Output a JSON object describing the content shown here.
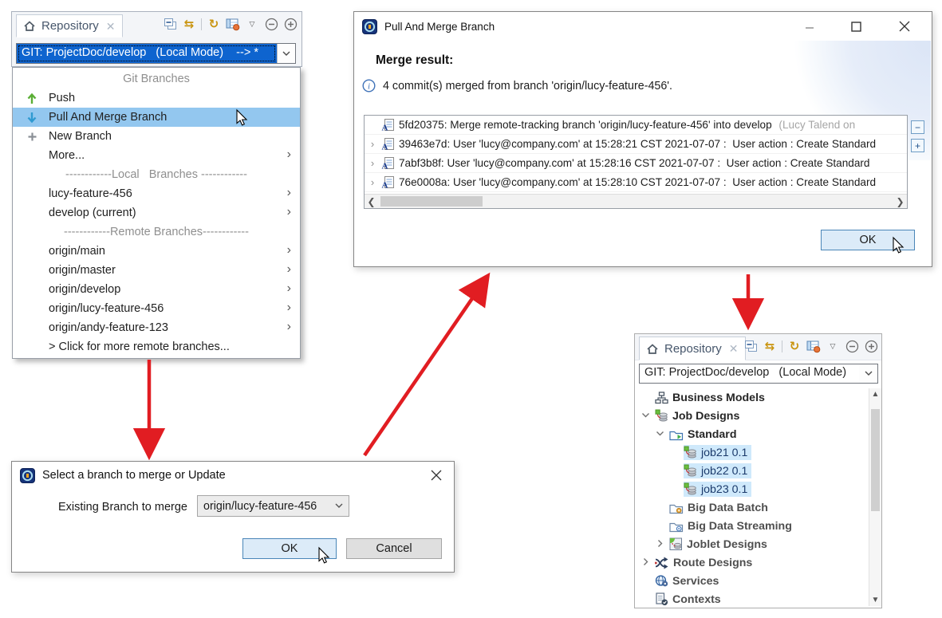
{
  "colors": {
    "selection_blue": "#0e64cf",
    "menu_highlight": "#93c7ef",
    "tree_selection": "#cfe9fb",
    "ok_button_bg": "#dcebf8",
    "ok_button_border": "#4a86b8",
    "arrow_red": "#e11d22",
    "toolbar_gold": "#c9940f"
  },
  "toolbar_icons": [
    {
      "name": "collapse-all-icon"
    },
    {
      "name": "switch-branch-icon"
    },
    {
      "name": "separator"
    },
    {
      "name": "refresh-icon"
    },
    {
      "name": "project-settings-icon"
    },
    {
      "name": "view-menu-icon"
    },
    {
      "name": "minimize-view-icon"
    },
    {
      "name": "maximize-view-icon"
    }
  ],
  "panel_top_left": {
    "tab_label": "Repository",
    "combo_value": "GIT: ProjectDoc/develop   (Local Mode)    --> *",
    "menu_items": [
      {
        "type": "header",
        "label": "Git Branches"
      },
      {
        "label": "Push",
        "icon": "push-arrow-up-icon"
      },
      {
        "label": "Pull And Merge Branch",
        "icon": "pull-arrow-down-icon",
        "highlighted": true
      },
      {
        "label": "New Branch",
        "icon": "plus-icon"
      },
      {
        "label": "More...",
        "submenu": true
      },
      {
        "type": "separator",
        "label": "------------Local   Branches ------------"
      },
      {
        "label": "lucy-feature-456",
        "submenu": true
      },
      {
        "label": "develop (current)",
        "submenu": true
      },
      {
        "type": "separator",
        "label": "------------Remote Branches------------"
      },
      {
        "label": "origin/main",
        "submenu": true
      },
      {
        "label": "origin/master",
        "submenu": true
      },
      {
        "label": "origin/develop",
        "submenu": true
      },
      {
        "label": "origin/lucy-feature-456",
        "submenu": true
      },
      {
        "label": "origin/andy-feature-123",
        "submenu": true
      },
      {
        "label": "> Click for more remote branches..."
      }
    ]
  },
  "dialog_merge": {
    "title": "Pull And Merge Branch",
    "heading": "Merge result:",
    "info_text": "4 commit(s) merged from branch 'origin/lucy-feature-456'.",
    "commits": [
      {
        "expandable": false,
        "text": "5fd20375: Merge remote-tracking branch 'origin/lucy-feature-456' into develop ",
        "suffix": "(Lucy Talend on"
      },
      {
        "expandable": true,
        "text": "39463e7d: User 'lucy@company.com' at 15:28:21 CST 2021-07-07 :  User action : Create Standard"
      },
      {
        "expandable": true,
        "text": "7abf3b8f: User 'lucy@company.com' at 15:28:16 CST 2021-07-07 :  User action : Create Standard"
      },
      {
        "expandable": true,
        "text": "76e0008a: User 'lucy@company.com' at 15:28:10 CST 2021-07-07 :  User action : Create Standard"
      }
    ],
    "ok_label": "OK"
  },
  "dialog_select": {
    "title": "Select a branch to merge or Update",
    "field_label": "Existing Branch to merge",
    "field_value": "origin/lucy-feature-456",
    "ok_label": "OK",
    "cancel_label": "Cancel"
  },
  "panel_bottom_right": {
    "tab_label": "Repository",
    "combo_value": "GIT: ProjectDoc/develop   (Local Mode)",
    "tree_items": [
      {
        "label": "Business Models",
        "icon": "business-models-icon",
        "level": 1,
        "bold": true
      },
      {
        "label": "Job Designs",
        "icon": "job-icon",
        "level": 1,
        "bold": true,
        "expander": "down"
      },
      {
        "label": "Standard",
        "icon": "folder-run-icon",
        "level": 2,
        "bold": true,
        "expander": "down"
      },
      {
        "label": "job21 0.1",
        "icon": "job-icon",
        "level": 3,
        "selected": true
      },
      {
        "label": "job22 0.1",
        "icon": "job-icon",
        "level": 3,
        "selected": true
      },
      {
        "label": "job23 0.1",
        "icon": "job-icon",
        "level": 3,
        "selected": true
      },
      {
        "label": "Big Data Batch",
        "icon": "folder-gear-icon",
        "level": 2,
        "bold": true,
        "dim": true
      },
      {
        "label": "Big Data Streaming",
        "icon": "folder-stream-icon",
        "level": 2,
        "bold": true,
        "dim": true
      },
      {
        "label": "Joblet Designs",
        "icon": "joblet-icon",
        "level": 2,
        "bold": true,
        "dim": true,
        "expander": "right"
      },
      {
        "label": "Route Designs",
        "icon": "route-icon",
        "level": 1,
        "bold": true,
        "dim": true,
        "expander": "right"
      },
      {
        "label": "Services",
        "icon": "services-icon",
        "level": 1,
        "bold": true,
        "dim": true
      },
      {
        "label": "Contexts",
        "icon": "contexts-icon",
        "level": 1,
        "bold": true,
        "dim": true
      }
    ]
  }
}
